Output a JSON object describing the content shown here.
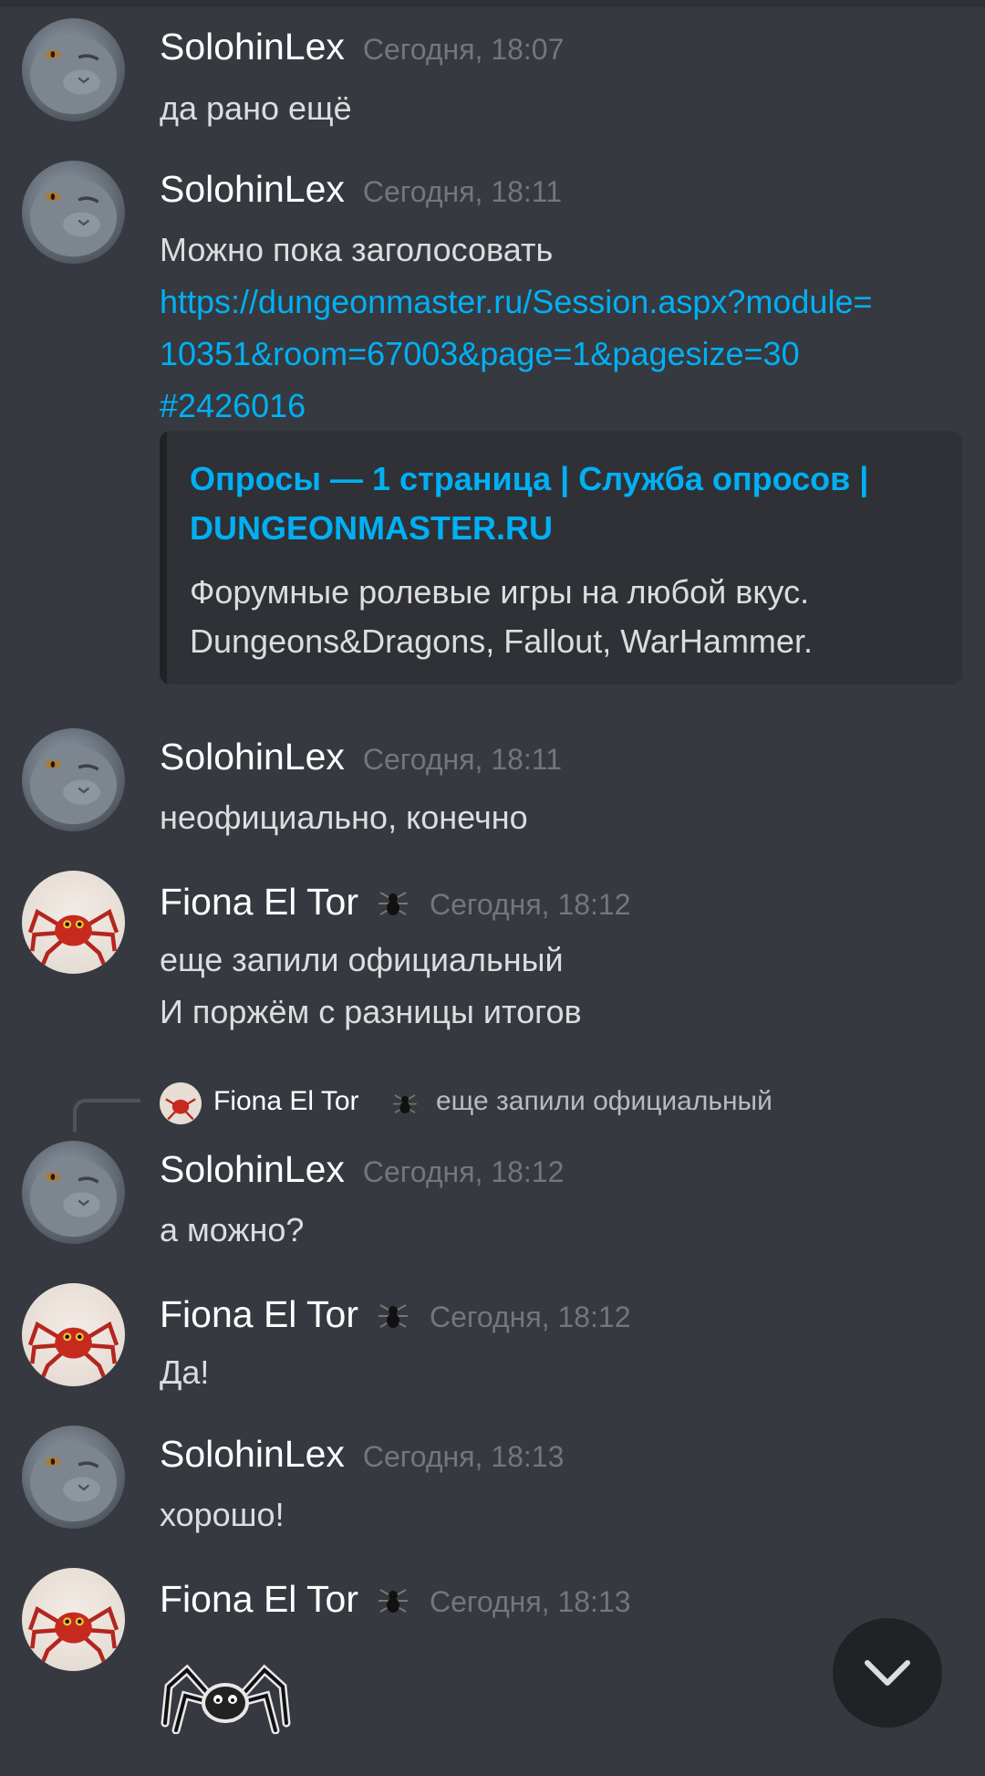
{
  "messages": [
    {
      "author": "SolohinLex",
      "time": "Сегодня, 18:07",
      "lines": [
        "да рано ещё"
      ]
    },
    {
      "author": "SolohinLex",
      "time": "Сегодня, 18:11",
      "lines": [
        "Можно пока заголосовать"
      ],
      "link_lines": [
        "https://dungeonmaster.ru/Session.aspx?module=",
        "10351&room=67003&page=1&pagesize=30",
        "#2426016"
      ],
      "embed": {
        "title_lines": [
          "Опросы — 1 страница | Служба опросов |",
          "DUNGEONMASTER.RU"
        ],
        "desc_lines": [
          "Форумные ролевые игры на любой вкус.",
          "Dungeons&Dragons, Fallout, WarHammer."
        ]
      }
    },
    {
      "author": "SolohinLex",
      "time": "Сегодня, 18:11",
      "lines": [
        "неофициально, конечно"
      ]
    },
    {
      "author": "Fiona El Tor",
      "time": "Сегодня, 18:12",
      "lines": [
        "еще запили официальный",
        "И поржём с разницы итогов"
      ]
    },
    {
      "author": "SolohinLex",
      "time": "Сегодня, 18:12",
      "lines": [
        "а можно?"
      ],
      "reply": {
        "author": "Fiona El Tor",
        "text": "еще запили официальный"
      }
    },
    {
      "author": "Fiona El Tor",
      "time": "Сегодня, 18:12",
      "lines": [
        "Да!"
      ]
    },
    {
      "author": "SolohinLex",
      "time": "Сегодня, 18:13",
      "lines": [
        "хорошо!"
      ]
    },
    {
      "author": "Fiona El Tor",
      "time": "Сегодня, 18:13",
      "lines": []
    }
  ],
  "icons": {
    "scroll": "chevron-down-icon",
    "badge": "spider-badge-icon",
    "sticker": "spider-sticker"
  },
  "colors": {
    "background": "#36393f",
    "link": "#00b0f4",
    "timestamp": "#72767d",
    "embed_bg": "#2f3136"
  }
}
